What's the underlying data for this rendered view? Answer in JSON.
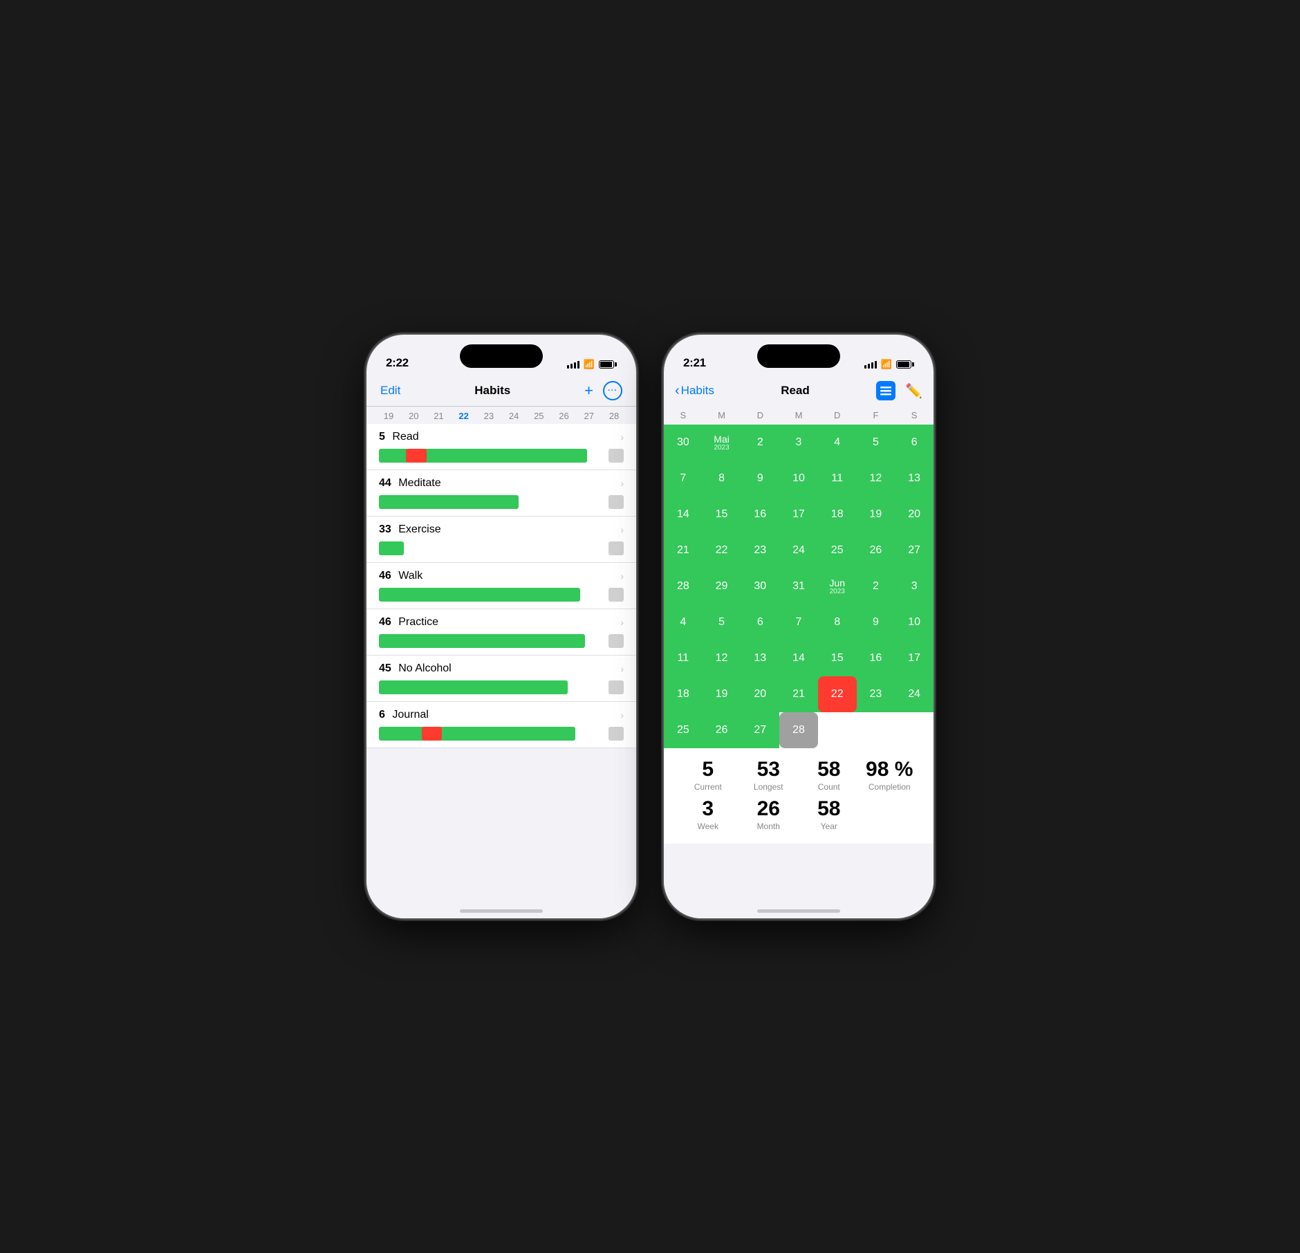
{
  "left_phone": {
    "time": "2:22",
    "nav": {
      "edit": "Edit",
      "title": "Habits",
      "plus": "+",
      "more": "···"
    },
    "dates": [
      "19",
      "20",
      "21",
      "22",
      "23",
      "24",
      "25",
      "26",
      "27",
      "28"
    ],
    "habits": [
      {
        "count": "5",
        "name": "Read",
        "bar_green_pct": 85,
        "has_red": true,
        "red_left_pct": 13,
        "red_width_pct": 10,
        "bar_width_pct": 93
      },
      {
        "count": "44",
        "name": "Meditate",
        "bar_green_pct": 65,
        "has_red": false,
        "bar_width_pct": 65
      },
      {
        "count": "33",
        "name": "Exercise",
        "bar_green_pct": 18,
        "has_red": false,
        "bar_width_pct": 18
      },
      {
        "count": "46",
        "name": "Walk",
        "bar_green_pct": 90,
        "has_red": false,
        "bar_width_pct": 90
      },
      {
        "count": "46",
        "name": "Practice",
        "bar_green_pct": 92,
        "has_red": false,
        "bar_width_pct": 92
      },
      {
        "count": "45",
        "name": "No Alcohol",
        "bar_green_pct": 85,
        "has_red": false,
        "bar_width_pct": 85
      },
      {
        "count": "6",
        "name": "Journal",
        "bar_green_pct": 88,
        "has_red": true,
        "red_left_pct": 22,
        "red_width_pct": 10,
        "bar_width_pct": 88
      }
    ]
  },
  "right_phone": {
    "time": "2:21",
    "nav": {
      "back": "Habits",
      "title": "Read"
    },
    "calendar_days": {
      "headers": [
        "S",
        "M",
        "D",
        "M",
        "D",
        "F",
        "S"
      ],
      "rows": [
        [
          {
            "num": "30",
            "green": true
          },
          {
            "num": "Mai",
            "sub": "2023",
            "green": true,
            "month_start": true
          },
          {
            "num": "2",
            "green": true
          },
          {
            "num": "3",
            "green": true
          },
          {
            "num": "4",
            "green": true
          },
          {
            "num": "5",
            "green": true
          },
          {
            "num": "6",
            "green": true
          }
        ],
        [
          {
            "num": "7",
            "green": true
          },
          {
            "num": "8",
            "green": true
          },
          {
            "num": "9",
            "green": true
          },
          {
            "num": "10",
            "green": true
          },
          {
            "num": "11",
            "green": true
          },
          {
            "num": "12",
            "green": true
          },
          {
            "num": "13",
            "green": true
          }
        ],
        [
          {
            "num": "14",
            "green": true
          },
          {
            "num": "15",
            "green": true
          },
          {
            "num": "16",
            "green": true
          },
          {
            "num": "17",
            "green": true
          },
          {
            "num": "18",
            "green": true
          },
          {
            "num": "19",
            "green": true
          },
          {
            "num": "20",
            "green": true
          }
        ],
        [
          {
            "num": "21",
            "green": true
          },
          {
            "num": "22",
            "green": true
          },
          {
            "num": "23",
            "green": true
          },
          {
            "num": "24",
            "green": true
          },
          {
            "num": "25",
            "green": true
          },
          {
            "num": "26",
            "green": true
          },
          {
            "num": "27",
            "green": true
          }
        ],
        [
          {
            "num": "28",
            "green": true
          },
          {
            "num": "29",
            "green": true
          },
          {
            "num": "30",
            "green": true
          },
          {
            "num": "31",
            "green": true
          },
          {
            "num": "Jun",
            "sub": "2023",
            "green": true,
            "month_start": true
          },
          {
            "num": "2",
            "green": true
          },
          {
            "num": "3",
            "green": true
          }
        ],
        [
          {
            "num": "4",
            "green": true
          },
          {
            "num": "5",
            "green": true
          },
          {
            "num": "6",
            "green": true
          },
          {
            "num": "7",
            "green": true
          },
          {
            "num": "8",
            "green": true
          },
          {
            "num": "9",
            "green": true
          },
          {
            "num": "10",
            "green": true
          }
        ],
        [
          {
            "num": "11",
            "green": true
          },
          {
            "num": "12",
            "green": true
          },
          {
            "num": "13",
            "green": true
          },
          {
            "num": "14",
            "green": true
          },
          {
            "num": "15",
            "green": true
          },
          {
            "num": "16",
            "green": true
          },
          {
            "num": "17",
            "green": true
          }
        ],
        [
          {
            "num": "18",
            "green": true
          },
          {
            "num": "19",
            "green": true
          },
          {
            "num": "20",
            "green": true
          },
          {
            "num": "21",
            "green": true
          },
          {
            "num": "22",
            "red": true
          },
          {
            "num": "23",
            "green": true
          },
          {
            "num": "24",
            "green": true
          }
        ],
        [
          {
            "num": "25",
            "green": true
          },
          {
            "num": "26",
            "green": true
          },
          {
            "num": "27",
            "green": true
          },
          {
            "num": "28",
            "gray": true
          },
          {
            "num": "",
            "empty": true
          },
          {
            "num": "",
            "empty": true
          },
          {
            "num": "",
            "empty": true
          }
        ]
      ]
    },
    "stats": {
      "row1": [
        {
          "value": "5",
          "label": "Current"
        },
        {
          "value": "53",
          "label": "Longest"
        },
        {
          "value": "58",
          "label": "Count"
        },
        {
          "value": "98 %",
          "label": "Completion"
        }
      ],
      "row2": [
        {
          "value": "3",
          "label": "Week"
        },
        {
          "value": "26",
          "label": "Month"
        },
        {
          "value": "58",
          "label": "Year"
        }
      ]
    }
  }
}
